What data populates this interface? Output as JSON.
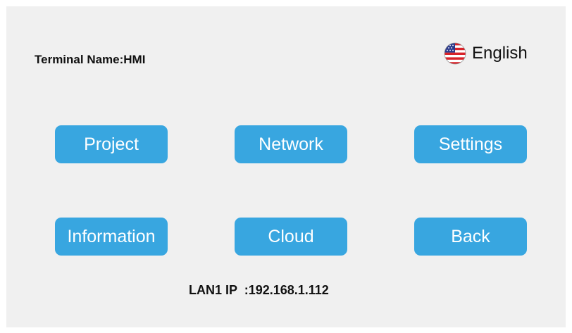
{
  "header": {
    "terminal_label": "Terminal Name:",
    "terminal_value": "HMI",
    "language": {
      "label": "English",
      "icon": "us-flag-icon"
    }
  },
  "menu": {
    "project": "Project",
    "network": "Network",
    "settings": "Settings",
    "information": "Information",
    "cloud": "Cloud",
    "back": "Back"
  },
  "footer": {
    "ip_label": "LAN1 IP  :",
    "ip_value": "192.168.1.112"
  },
  "colors": {
    "background": "#f0f0f0",
    "button": "#38a6e0",
    "button_text": "#ffffff"
  }
}
